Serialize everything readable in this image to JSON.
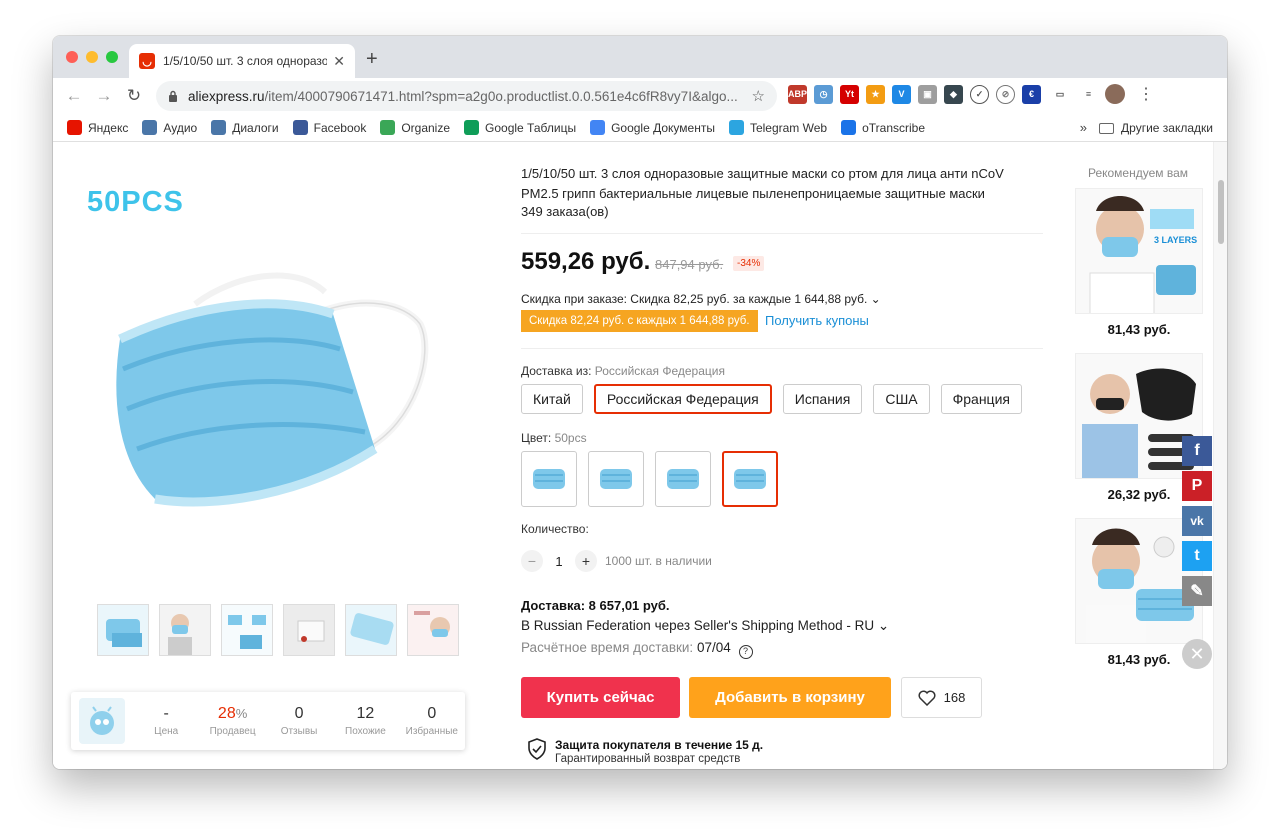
{
  "browser": {
    "tab_title": "1/5/10/50 шт. 3 слоя одноразо",
    "url_host": "aliexpress.ru",
    "url_path": "/item/4000790671471.html?spm=a2g0o.productlist.0.0.561e4c6fR8vy7I&algo...",
    "bookmarks": [
      {
        "label": "Яндекс",
        "icon": "yandex-icon",
        "color": "#e61400"
      },
      {
        "label": "Аудио",
        "icon": "vk-icon",
        "color": "#4a76a8"
      },
      {
        "label": "Диалоги",
        "icon": "chat-icon",
        "color": "#4a76a8"
      },
      {
        "label": "Facebook",
        "icon": "facebook-icon",
        "color": "#3b5998"
      },
      {
        "label": "Organize",
        "icon": "organize-icon",
        "color": "#3aa757"
      },
      {
        "label": "Google Таблицы",
        "icon": "sheets-icon",
        "color": "#0f9d58"
      },
      {
        "label": "Google Документы",
        "icon": "docs-icon",
        "color": "#4285f4"
      },
      {
        "label": "Telegram Web",
        "icon": "telegram-icon",
        "color": "#2ca5e0"
      },
      {
        "label": "oTranscribe",
        "icon": "otranscribe-icon",
        "color": "#1a73e8"
      }
    ],
    "other_bookmarks": "Другие закладки",
    "more": "»"
  },
  "product": {
    "main_label": "50PCS",
    "title": "1/5/10/50 шт. 3 слоя одноразовые защитные маски со ртом для лица анти nCoV PM2.5 грипп бактериальные лицевые пыленепроницаемые защитные маски",
    "orders": "349 заказа(ов)",
    "price": "559,26 руб.",
    "old_price": "847,94 руб.",
    "discount": "-34%",
    "order_discount": "Скидка при заказе: Скидка 82,25 руб. за каждые 1 644,88 руб. ⌄",
    "coupon_tag": "Скидка 82,24 руб. с каждых 1 644,88 руб.",
    "coupon_link": "Получить купоны",
    "ship_from_label": "Доставка из:",
    "ship_from_value": "Российская Федерация",
    "countries": [
      "Китай",
      "Российская Федерация",
      "Испания",
      "США",
      "Франция"
    ],
    "selected_country": "Российская Федерация",
    "color_label": "Цвет:",
    "color_value": "50pcs",
    "qty_label": "Количество:",
    "qty_value": "1",
    "qty_minus": "−",
    "qty_plus": "+",
    "stock": "1000 шт. в наличии",
    "delivery_title": "Доставка: 8 657,01 руб.",
    "delivery_method": "В Russian Federation через Seller's Shipping Method - RU ⌄",
    "delivery_time_label": "Расчётное время доставки:",
    "delivery_time_value": "07/04",
    "buy_now": "Купить сейчас",
    "add_cart": "Добавить в корзину",
    "wishlist_count": "168",
    "protect_title": "Защита покупателя в течение 15 д.",
    "protect_sub": "Гарантированный возврат средств"
  },
  "store_stats": [
    {
      "value": "-",
      "label": "Цена"
    },
    {
      "value": "28",
      "suffix": "%",
      "label": "Продавец"
    },
    {
      "value": "0",
      "label": "Отзывы"
    },
    {
      "value": "12",
      "label": "Похожие"
    },
    {
      "value": "0",
      "label": "Избранные"
    }
  ],
  "recommend": {
    "title": "Рекомендуем вам",
    "items": [
      {
        "price": "81,43 руб."
      },
      {
        "price": "26,32 руб."
      },
      {
        "price": "81,43 руб."
      }
    ]
  },
  "colors": {
    "accent": "#e62e04",
    "buy": "#f0324d",
    "cart": "#ffa21b",
    "coupon": "#f6a521",
    "link": "#1a8fd6",
    "mask": "#7ec8ea"
  }
}
